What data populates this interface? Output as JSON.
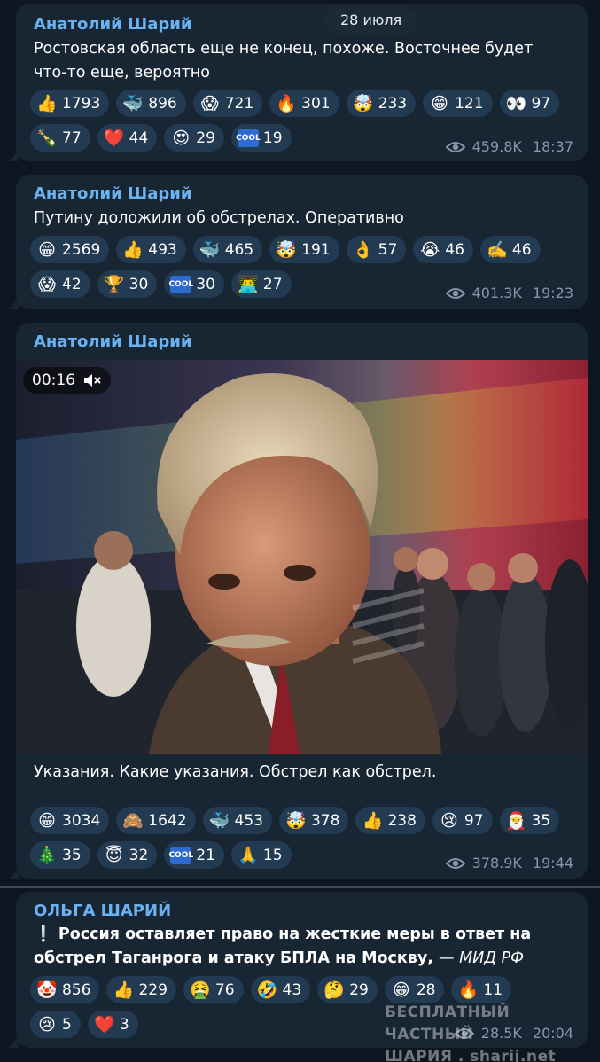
{
  "date_separator": "28 июля",
  "posts": [
    {
      "author": "Анатолий Шарий",
      "text": "Ростовская область еще не конец, похоже. Восточнее будет что-то еще, вероятно",
      "reactions": [
        {
          "emoji": "👍",
          "count": "1793"
        },
        {
          "emoji": "🐳",
          "count": "896"
        },
        {
          "emoji": "😱",
          "count": "721"
        },
        {
          "emoji": "🔥",
          "count": "301"
        },
        {
          "emoji": "🤯",
          "count": "233"
        },
        {
          "emoji": "😁",
          "count": "121"
        },
        {
          "emoji": "👀",
          "count": "97"
        },
        {
          "emoji": "🍾",
          "count": "77"
        },
        {
          "emoji": "❤️",
          "count": "44"
        },
        {
          "emoji": "😍",
          "count": "29"
        },
        {
          "emoji": "COOL",
          "count": "19"
        }
      ],
      "views": "459.8K",
      "time": "18:37"
    },
    {
      "author": "Анатолий Шарий",
      "text": "Путину доложили об обстрелах. Оперативно",
      "reactions": [
        {
          "emoji": "😁",
          "count": "2569"
        },
        {
          "emoji": "👍",
          "count": "493"
        },
        {
          "emoji": "🐳",
          "count": "465"
        },
        {
          "emoji": "🤯",
          "count": "191"
        },
        {
          "emoji": "👌",
          "count": "57"
        },
        {
          "emoji": "😭",
          "count": "46"
        },
        {
          "emoji": "✍️",
          "count": "46"
        },
        {
          "emoji": "😱",
          "count": "42"
        },
        {
          "emoji": "🏆",
          "count": "30"
        },
        {
          "emoji": "COOL",
          "count": "30"
        },
        {
          "emoji": "👨‍💻",
          "count": "27"
        }
      ],
      "views": "401.3K",
      "time": "19:23"
    },
    {
      "author": "Анатолий Шарий",
      "video_duration": "00:16",
      "text": "Указания. Какие указания. Обстрел как обстрел.",
      "reactions": [
        {
          "emoji": "😁",
          "count": "3034"
        },
        {
          "emoji": "🙈",
          "count": "1642"
        },
        {
          "emoji": "🐳",
          "count": "453"
        },
        {
          "emoji": "🤯",
          "count": "378"
        },
        {
          "emoji": "👍",
          "count": "238"
        },
        {
          "emoji": "😢",
          "count": "97"
        },
        {
          "emoji": "🎅",
          "count": "35"
        },
        {
          "emoji": "🎄",
          "count": "35"
        },
        {
          "emoji": "😇",
          "count": "32"
        },
        {
          "emoji": "COOL",
          "count": "21"
        },
        {
          "emoji": "🙏",
          "count": "15"
        }
      ],
      "views": "378.9K",
      "time": "19:44"
    },
    {
      "author": "ОЛЬГА ШАРИЙ",
      "text_icon": "❕",
      "text": "Россия оставляет право на жесткие меры в ответ на обстрел Таганрога и атаку БПЛА на Москву,",
      "text_source": "— МИД РФ",
      "reactions": [
        {
          "emoji": "🤡",
          "count": "856"
        },
        {
          "emoji": "👍",
          "count": "229"
        },
        {
          "emoji": "🤮",
          "count": "76"
        },
        {
          "emoji": "🤣",
          "count": "43"
        },
        {
          "emoji": "🤔",
          "count": "29"
        },
        {
          "emoji": "😁",
          "count": "28"
        },
        {
          "emoji": "🔥",
          "count": "11"
        },
        {
          "emoji": "😢",
          "count": "5"
        },
        {
          "emoji": "❤️",
          "count": "3"
        }
      ],
      "views": "28.5K",
      "time": "20:04"
    }
  ],
  "watermark": {
    "line1": "БЕСПЛАТНЫЙ ЧАСТНЫЙ",
    "line2": "ШАРИЯ . sharij.net"
  },
  "colors": {
    "background": "#0e1621",
    "bubble": "#182533",
    "author": "#6ab2f2",
    "reaction_bg": "#223a52",
    "meta": "#8797a7"
  }
}
